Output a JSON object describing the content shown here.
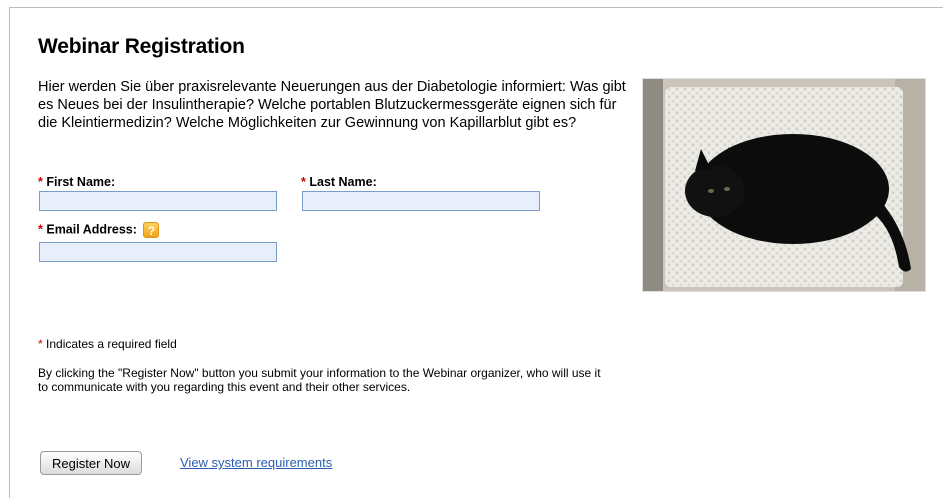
{
  "form": {
    "title": "Webinar Registration",
    "intro": "Hier werden Sie über praxisrelevante Neuerungen aus der Diabetologie informiert: Was gibt es Neues bei der Insulintherapie? Welche portablen Blutzuckermessgeräte eignen sich für die Kleintiermedizin? Welche Möglichkeiten zur Gewinnung von Kapillarblut gibt es?",
    "required_marker": "*",
    "first_name": {
      "label": "First Name:",
      "value": ""
    },
    "last_name": {
      "label": "Last Name:",
      "value": ""
    },
    "email": {
      "label": "Email Address:",
      "value": "",
      "help_icon": "question-icon",
      "help_glyph": "?"
    },
    "required_note": "Indicates a required field",
    "disclaimer": "By clicking the \"Register Now\" button you submit your information to the Webinar organizer, who will use it to communicate with you regarding this event and their other services.",
    "register_button": "Register Now",
    "system_requirements_link": "View system requirements"
  },
  "colors": {
    "required": "#cc0000",
    "input_bg": "#e8eefa",
    "input_border": "#7a9cc7",
    "link": "#2a5db0",
    "help_icon": "#f2a31a"
  },
  "photo": {
    "subject": "black-cat-photo"
  }
}
